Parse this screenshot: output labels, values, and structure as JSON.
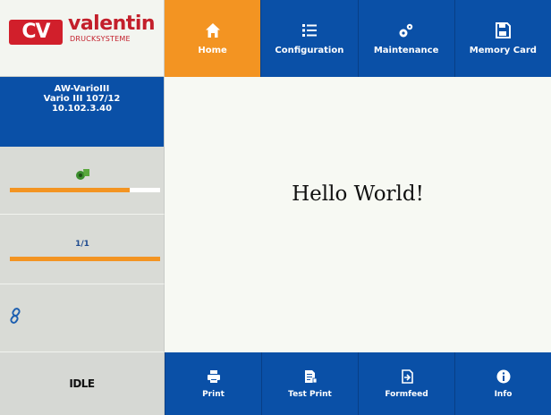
{
  "logo": {
    "mark": "CV",
    "name": "valentin",
    "sub": "DRUCKSYSTEME"
  },
  "nav": [
    {
      "label": "Home",
      "icon": "home-icon",
      "active": true
    },
    {
      "label": "Configuration",
      "icon": "list-icon",
      "active": false
    },
    {
      "label": "Maintenance",
      "icon": "gears-icon",
      "active": false
    },
    {
      "label": "Memory Card",
      "icon": "floppy-icon",
      "active": false
    }
  ],
  "device": {
    "model": "AW-VarioIII",
    "variant": "Vario III 107/12",
    "ip": "10.102.3.40"
  },
  "label_supply": {
    "icon": "label-roll-icon",
    "level": 0.8
  },
  "job": {
    "count": "1/1",
    "progress": 1.0
  },
  "connection": {
    "icon": "link-icon"
  },
  "status": "IDLE",
  "content": {
    "text": "Hello World!"
  },
  "actions": [
    {
      "label": "Print",
      "icon": "printer-icon"
    },
    {
      "label": "Test Print",
      "icon": "test-print-icon"
    },
    {
      "label": "Formfeed",
      "icon": "formfeed-icon"
    },
    {
      "label": "Info",
      "icon": "info-icon"
    }
  ],
  "colors": {
    "brand_red": "#d11f2b",
    "nav_blue": "#0a50a7",
    "active_orange": "#f39422",
    "panel_gray": "#d9dbd6"
  }
}
